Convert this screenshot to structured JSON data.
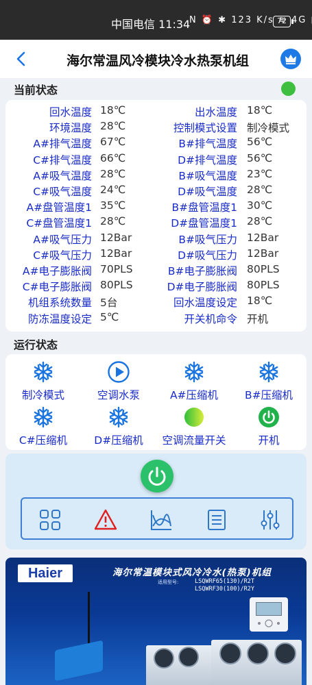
{
  "status_bar": {
    "carrier_time": "中国电信 11:34",
    "icons_text": "N ⏰ ✱ 123 K/s ≋ 4G ▮",
    "battery": "72"
  },
  "app_bar": {
    "title": "海尔常温风冷模块冷水热泵机组",
    "back_icon": "chevron-left-icon",
    "crown_icon": "crown-icon"
  },
  "current_status": {
    "label": "当前状态",
    "indicator_color": "#3fbf3f",
    "rows": [
      {
        "l1": "回水温度",
        "v1": "18℃",
        "l2": "出水温度",
        "v2": "18℃"
      },
      {
        "l1": "环境温度",
        "v1": "28℃",
        "l2": "控制模式设置",
        "v2": "制冷模式"
      },
      {
        "l1": "A#排气温度",
        "v1": "67℃",
        "l2": "B#排气温度",
        "v2": "56℃"
      },
      {
        "l1": "C#排气温度",
        "v1": "66℃",
        "l2": "D#排气温度",
        "v2": "56℃"
      },
      {
        "l1": "A#吸气温度",
        "v1": "28℃",
        "l2": "B#吸气温度",
        "v2": "23℃"
      },
      {
        "l1": "C#吸气温度",
        "v1": "24℃",
        "l2": "D#吸气温度",
        "v2": "28℃"
      },
      {
        "l1": "A#盘管温度1",
        "v1": "35℃",
        "l2": "B#盘管温度1",
        "v2": "30℃"
      },
      {
        "l1": "C#盘管温度1",
        "v1": "28℃",
        "l2": "D#盘管温度1",
        "v2": "28℃"
      },
      {
        "l1": "A#吸气压力",
        "v1": "12Bar",
        "l2": "B#吸气压力",
        "v2": "12Bar"
      },
      {
        "l1": "C#吸气压力",
        "v1": "12Bar",
        "l2": "D#吸气压力",
        "v2": "12Bar"
      },
      {
        "l1": "A#电子膨胀阀",
        "v1": "70PLS",
        "l2": "B#电子膨胀阀",
        "v2": "80PLS"
      },
      {
        "l1": "C#电子膨胀阀",
        "v1": "80PLS",
        "l2": "D#电子膨胀阀",
        "v2": "80PLS"
      },
      {
        "l1": "机组系统数量",
        "v1": "5台",
        "l2": "回水温度设定",
        "v2": "18℃"
      },
      {
        "l1": "防冻温度设定",
        "v1": "5℃",
        "l2": "开关机命令",
        "v2": "开机"
      }
    ]
  },
  "run_status": {
    "label": "运行状态",
    "items": [
      {
        "label": "制冷模式",
        "icon": "snowflake-icon"
      },
      {
        "label": "空调水泵",
        "icon": "play-icon"
      },
      {
        "label": "A#压缩机",
        "icon": "snowflake-icon"
      },
      {
        "label": "B#压缩机",
        "icon": "snowflake-icon"
      },
      {
        "label": "C#压缩机",
        "icon": "snowflake-icon"
      },
      {
        "label": "D#压缩机",
        "icon": "snowflake-icon"
      },
      {
        "label": "空调流量开关",
        "icon": "green-ball-icon"
      },
      {
        "label": "开机",
        "icon": "power-icon"
      }
    ]
  },
  "controls": {
    "power_icon": "power-icon",
    "toolbar": [
      "grid-icon",
      "alarm-icon",
      "curve-icon",
      "list-icon",
      "sliders-icon"
    ]
  },
  "banner": {
    "brand": "Haier",
    "title": "海尔常温模块式风冷冷水(热泵)机组",
    "model_label": "适用型号:",
    "models": [
      "LSQWRF65(130)/R2T",
      "LSQWRF30(100)/R2Y"
    ]
  }
}
